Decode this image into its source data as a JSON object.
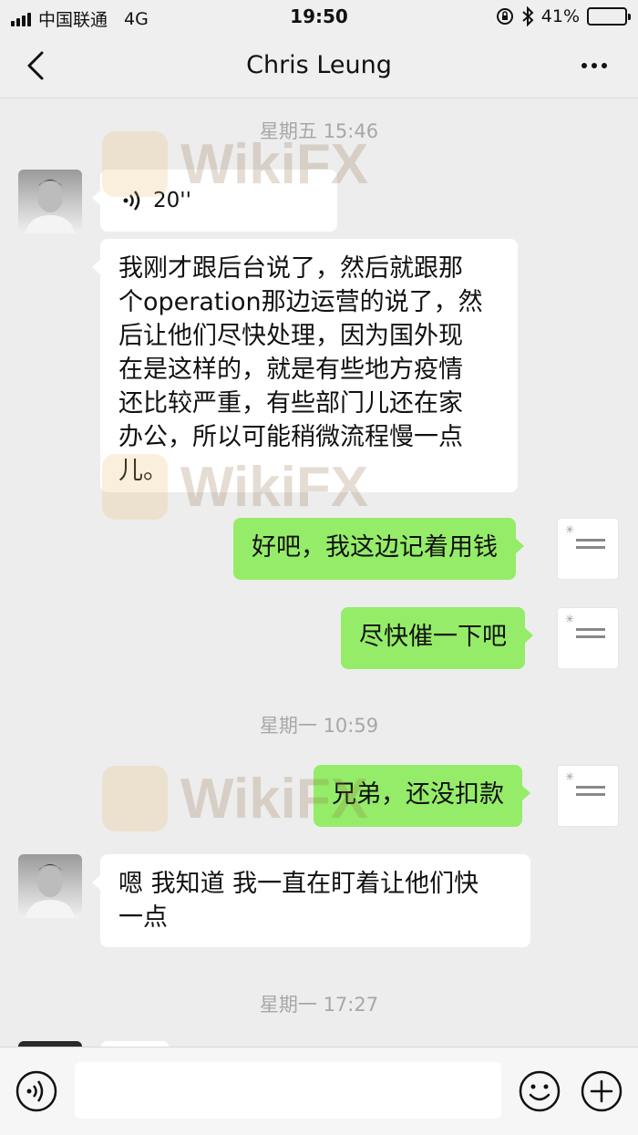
{
  "status_bar": {
    "carrier": "中国联通",
    "network": "4G",
    "time": "19:50",
    "battery": "41%",
    "battery_level": 0.41
  },
  "nav": {
    "title": "Chris Leung"
  },
  "messages": [
    {
      "type": "timestamp",
      "text": "星期五 15:46"
    },
    {
      "type": "voice",
      "direction": "in",
      "duration": "20''"
    },
    {
      "type": "text",
      "direction": "in",
      "lines": [
        "我刚才跟后台说了，然后就跟那",
        "个operation那边运营的说了，然",
        "后让他们尽快处理，因为国外现",
        "在是这样的，就是有些地方疫情",
        "还比较严重，有些部门儿还在家",
        "办公，所以可能稍微流程慢一点",
        "儿。"
      ]
    },
    {
      "type": "text",
      "direction": "out",
      "lines": [
        "好吧，我这边记着用钱"
      ]
    },
    {
      "type": "text",
      "direction": "out",
      "lines": [
        "尽快催一下吧"
      ]
    },
    {
      "type": "timestamp",
      "text": "星期一 10:59"
    },
    {
      "type": "text",
      "direction": "out",
      "lines": [
        "兄弟，还没扣款"
      ]
    },
    {
      "type": "text",
      "direction": "in",
      "lines": [
        "嗯 我知道 我一直在盯着让他们快",
        "一点"
      ]
    },
    {
      "type": "timestamp",
      "text": "星期一 17:27"
    }
  ],
  "watermark": "WikiFX",
  "colors": {
    "background": "#ededed",
    "outgoing_bubble": "#95ec69",
    "incoming_bubble": "#ffffff"
  }
}
